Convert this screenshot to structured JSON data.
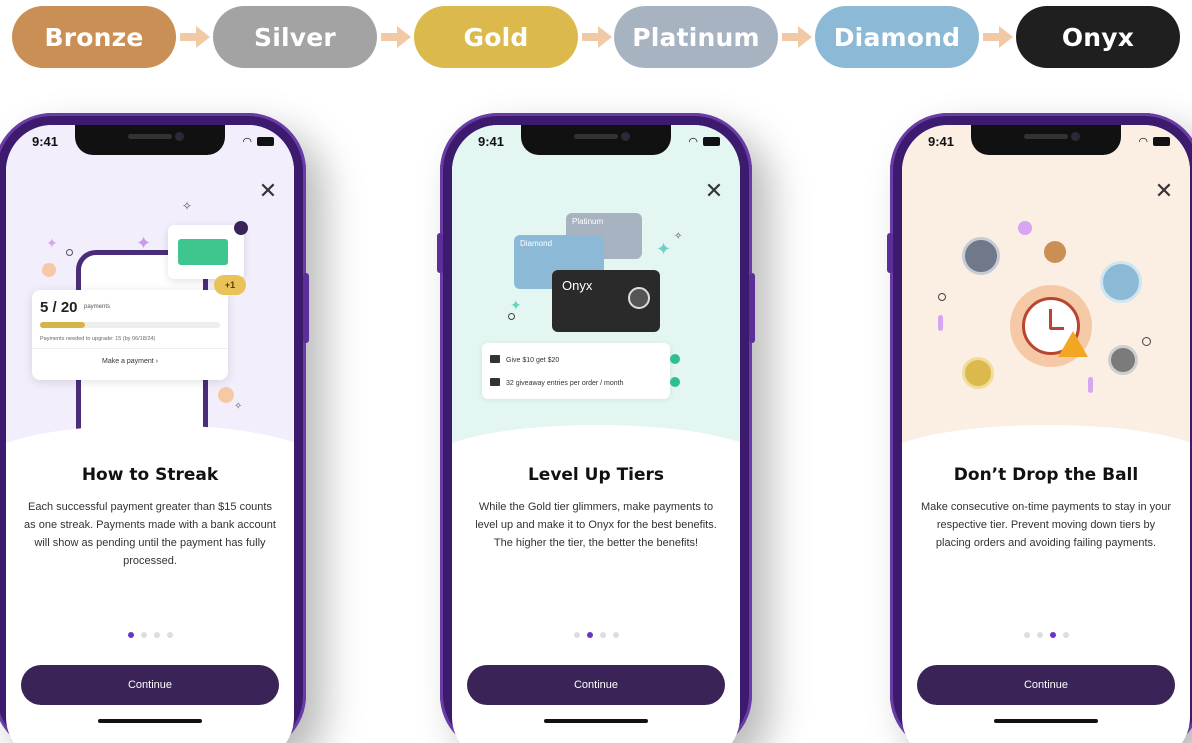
{
  "tiers": [
    {
      "label": "Bronze",
      "color": "#c98f55"
    },
    {
      "label": "Silver",
      "color": "#a3a3a3"
    },
    {
      "label": "Gold",
      "color": "#dbb94d"
    },
    {
      "label": "Platinum",
      "color": "#a7b3c0"
    },
    {
      "label": "Diamond",
      "color": "#8cbad6"
    },
    {
      "label": "Onyx",
      "color": "#1f1f1f"
    }
  ],
  "arrow_color": "#f1c9a4",
  "status_time": "9:41",
  "continue_label": "Continue",
  "phones": [
    {
      "title": "How to Streak",
      "body": "Each successful payment greater than $15 counts as one streak. Payments made with a bank account will show as pending until the payment has fully processed.",
      "hero_color": "#f3eefb",
      "active_dot": 0,
      "card": {
        "count": "5 / 20",
        "count_label": "payments",
        "progress_fraction": 0.25,
        "note": "Payments needed to upgrade: 15 (by 06/18/24)",
        "link": "Make a payment  ›",
        "badge": "+1"
      }
    },
    {
      "title": "Level Up Tiers",
      "body": "While the Gold tier glimmers, make payments to level up and make it to Onyx for the best benefits. The higher the tier, the better the benefits!",
      "hero_color": "#e3f6f1",
      "active_dot": 1,
      "tier_cards": [
        "Platinum",
        "Diamond",
        "Onyx"
      ],
      "perks": [
        "Give $10 get $20",
        "32 giveaway entries per order / month"
      ]
    },
    {
      "title": "Don’t Drop the Ball",
      "body": "Make consecutive on-time payments to stay in your respective tier. Prevent moving down tiers by placing orders and avoiding failing payments.",
      "hero_color": "#fbeee2",
      "active_dot": 2
    }
  ]
}
